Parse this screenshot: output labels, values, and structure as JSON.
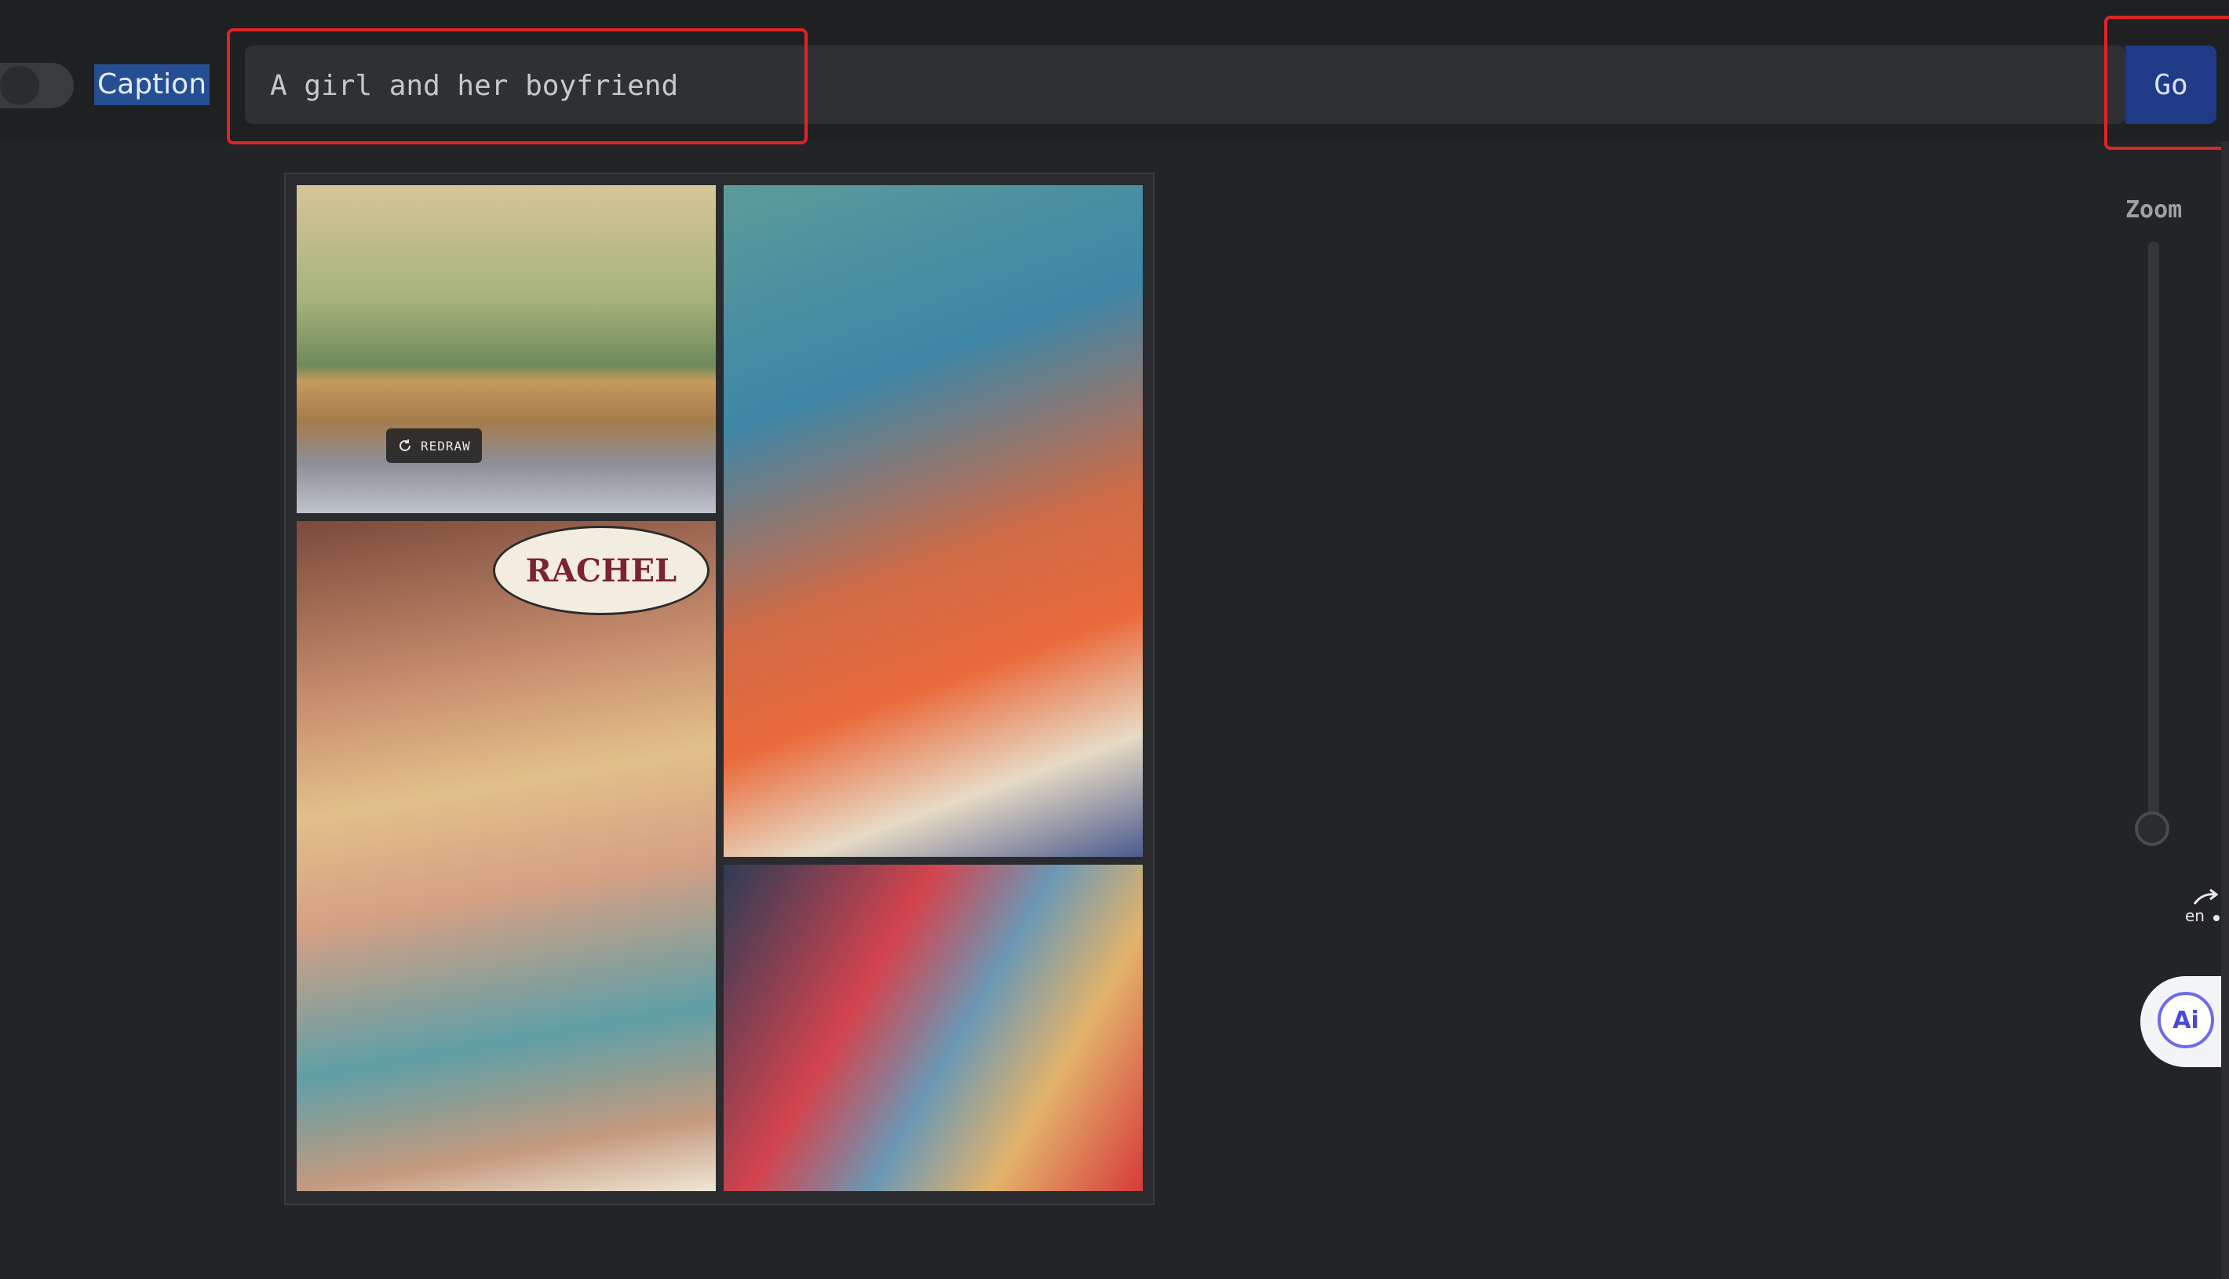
{
  "header": {
    "caption_label": "Caption",
    "prompt_value": "A girl and her boyfriend",
    "go_label": "Go"
  },
  "canvas": {
    "bubble_text": "RACHEL",
    "redraw_label": "REDRAW"
  },
  "zoom": {
    "label": "Zoom",
    "level": 0.0
  },
  "widgets": {
    "translate_icon": "translate-icon",
    "ai_label": "Ai"
  },
  "colors": {
    "highlight": "#e02424",
    "go_button": "#1f3a86",
    "caption_highlight": "#264f93"
  }
}
